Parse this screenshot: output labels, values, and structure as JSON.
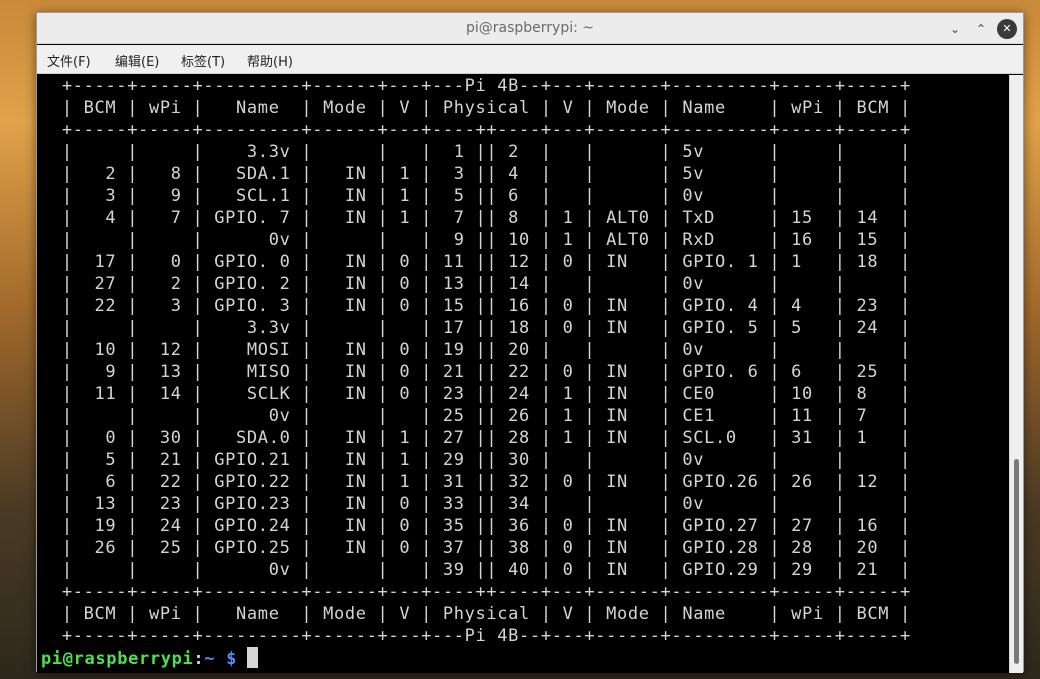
{
  "window": {
    "title": "pi@raspberrypi: ~",
    "controls": {
      "minimize": "⌄",
      "maximize": "⌃",
      "close": "✕"
    }
  },
  "menu": [
    "文件(F)",
    "编辑(E)",
    "标签(T)",
    "帮助(H)"
  ],
  "terminal": {
    "table_lines": [
      " +-----+-----+---------+------+---+---Pi 4B--+---+------+---------+-----+-----+",
      " | BCM | wPi |   Name  | Mode | V | Physical | V | Mode | Name    | wPi | BCM |",
      " +-----+-----+---------+------+---+----++----+---+------+---------+-----+-----+",
      " |     |     |    3.3v |      |   |  1 || 2  |   |      | 5v      |     |     |",
      " |   2 |   8 |   SDA.1 |   IN | 1 |  3 || 4  |   |      | 5v      |     |     |",
      " |   3 |   9 |   SCL.1 |   IN | 1 |  5 || 6  |   |      | 0v      |     |     |",
      " |   4 |   7 | GPIO. 7 |   IN | 1 |  7 || 8  | 1 | ALT0 | TxD     | 15  | 14  |",
      " |     |     |      0v |      |   |  9 || 10 | 1 | ALT0 | RxD     | 16  | 15  |",
      " |  17 |   0 | GPIO. 0 |   IN | 0 | 11 || 12 | 0 | IN   | GPIO. 1 | 1   | 18  |",
      " |  27 |   2 | GPIO. 2 |   IN | 0 | 13 || 14 |   |      | 0v      |     |     |",
      " |  22 |   3 | GPIO. 3 |   IN | 0 | 15 || 16 | 0 | IN   | GPIO. 4 | 4   | 23  |",
      " |     |     |    3.3v |      |   | 17 || 18 | 0 | IN   | GPIO. 5 | 5   | 24  |",
      " |  10 |  12 |    MOSI |   IN | 0 | 19 || 20 |   |      | 0v      |     |     |",
      " |   9 |  13 |    MISO |   IN | 0 | 21 || 22 | 0 | IN   | GPIO. 6 | 6   | 25  |",
      " |  11 |  14 |    SCLK |   IN | 0 | 23 || 24 | 1 | IN   | CE0     | 10  | 8   |",
      " |     |     |      0v |      |   | 25 || 26 | 1 | IN   | CE1     | 11  | 7   |",
      " |   0 |  30 |   SDA.0 |   IN | 1 | 27 || 28 | 1 | IN   | SCL.0   | 31  | 1   |",
      " |   5 |  21 | GPIO.21 |   IN | 1 | 29 || 30 |   |      | 0v      |     |     |",
      " |   6 |  22 | GPIO.22 |   IN | 1 | 31 || 32 | 0 | IN   | GPIO.26 | 26  | 12  |",
      " |  13 |  23 | GPIO.23 |   IN | 0 | 33 || 34 |   |      | 0v      |     |     |",
      " |  19 |  24 | GPIO.24 |   IN | 0 | 35 || 36 | 0 | IN   | GPIO.27 | 27  | 16  |",
      " |  26 |  25 | GPIO.25 |   IN | 0 | 37 || 38 | 0 | IN   | GPIO.28 | 28  | 20  |",
      " |     |     |      0v |      |   | 39 || 40 | 0 | IN   | GPIO.29 | 29  | 21  |",
      " +-----+-----+---------+------+---+----++----+---+------+---------+-----+-----+",
      " | BCM | wPi |   Name  | Mode | V | Physical | V | Mode | Name    | wPi | BCM |",
      " +-----+-----+---------+------+---+---Pi 4B--+---+------+---------+-----+-----+"
    ],
    "prompt": {
      "user": "pi@raspberrypi",
      "sep": ":",
      "path": "~",
      "symbol": "$"
    }
  }
}
